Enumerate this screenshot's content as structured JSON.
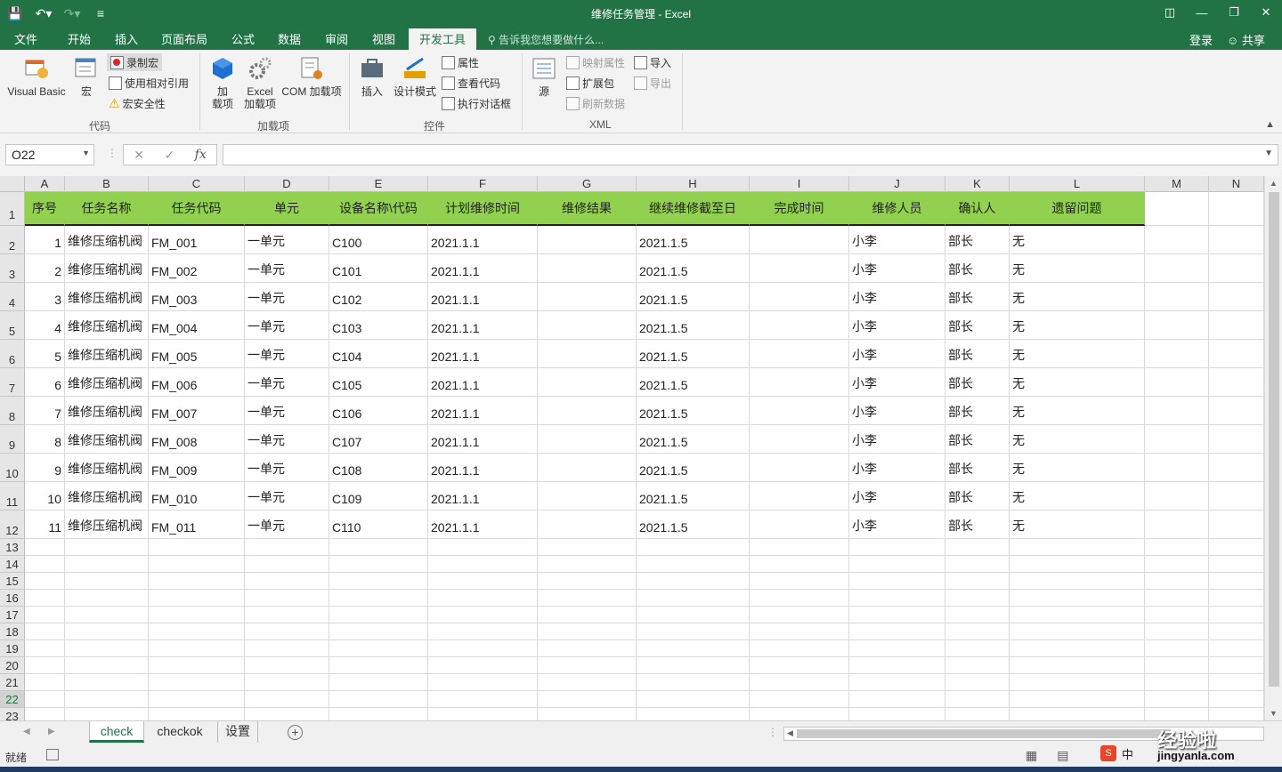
{
  "window": {
    "title": "维修任务管理 - Excel",
    "accent": "#217346"
  },
  "menu": {
    "tabs": [
      "文件",
      "开始",
      "插入",
      "页面布局",
      "公式",
      "数据",
      "审阅",
      "视图",
      "开发工具"
    ],
    "active_tab": "开发工具",
    "tell_me": "告诉我您想要做什么...",
    "login": "登录",
    "share": "共享"
  },
  "ribbon": {
    "code": {
      "group_label": "代码",
      "visual_basic": "Visual Basic",
      "macros": "宏",
      "record_macro": "录制宏",
      "relative_ref": "使用相对引用",
      "macro_security": "宏安全性"
    },
    "addins": {
      "group_label": "加载项",
      "addins": "加\n载项",
      "excel_addins": "Excel\n加载项",
      "com_addins": "COM 加载项"
    },
    "controls": {
      "group_label": "控件",
      "insert": "插入",
      "design_mode": "设计模式",
      "properties": "属性",
      "view_code": "查看代码",
      "run_dialog": "执行对话框"
    },
    "xml": {
      "group_label": "XML",
      "source": "源",
      "map_properties": "映射属性",
      "expansion_packs": "扩展包",
      "refresh_data": "刷新数据",
      "import": "导入",
      "export": "导出"
    }
  },
  "formula_bar": {
    "name_box": "O22",
    "fx": "fx",
    "value": ""
  },
  "sheet": {
    "columns": [
      "A",
      "B",
      "C",
      "D",
      "E",
      "F",
      "G",
      "H",
      "I",
      "J",
      "K",
      "L",
      "M",
      "N"
    ],
    "header_fill": "#92d050",
    "headers": [
      "序号",
      "任务名称",
      "任务代码",
      "单元",
      "设备名称\\代码",
      "计划维修时间",
      "维修结果",
      "继续维修截至日",
      "完成时间",
      "维修人员",
      "确认人",
      "遗留问题"
    ],
    "rows": [
      [
        "1",
        "维修压缩机阀",
        "FM_001",
        "一单元",
        "C100",
        "2021.1.1",
        "",
        "2021.1.5",
        "",
        "小李",
        "部长",
        "无"
      ],
      [
        "2",
        "维修压缩机阀",
        "FM_002",
        "一单元",
        "C101",
        "2021.1.1",
        "",
        "2021.1.5",
        "",
        "小李",
        "部长",
        "无"
      ],
      [
        "3",
        "维修压缩机阀",
        "FM_003",
        "一单元",
        "C102",
        "2021.1.1",
        "",
        "2021.1.5",
        "",
        "小李",
        "部长",
        "无"
      ],
      [
        "4",
        "维修压缩机阀",
        "FM_004",
        "一单元",
        "C103",
        "2021.1.1",
        "",
        "2021.1.5",
        "",
        "小李",
        "部长",
        "无"
      ],
      [
        "5",
        "维修压缩机阀",
        "FM_005",
        "一单元",
        "C104",
        "2021.1.1",
        "",
        "2021.1.5",
        "",
        "小李",
        "部长",
        "无"
      ],
      [
        "6",
        "维修压缩机阀",
        "FM_006",
        "一单元",
        "C105",
        "2021.1.1",
        "",
        "2021.1.5",
        "",
        "小李",
        "部长",
        "无"
      ],
      [
        "7",
        "维修压缩机阀",
        "FM_007",
        "一单元",
        "C106",
        "2021.1.1",
        "",
        "2021.1.5",
        "",
        "小李",
        "部长",
        "无"
      ],
      [
        "8",
        "维修压缩机阀",
        "FM_008",
        "一单元",
        "C107",
        "2021.1.1",
        "",
        "2021.1.5",
        "",
        "小李",
        "部长",
        "无"
      ],
      [
        "9",
        "维修压缩机阀",
        "FM_009",
        "一单元",
        "C108",
        "2021.1.1",
        "",
        "2021.1.5",
        "",
        "小李",
        "部长",
        "无"
      ],
      [
        "10",
        "维修压缩机阀",
        "FM_010",
        "一单元",
        "C109",
        "2021.1.1",
        "",
        "2021.1.5",
        "",
        "小李",
        "部长",
        "无"
      ],
      [
        "11",
        "维修压缩机阀",
        "FM_011",
        "一单元",
        "C110",
        "2021.1.1",
        "",
        "2021.1.5",
        "",
        "小李",
        "部长",
        "无"
      ]
    ],
    "row_numbers": [
      "1",
      "2",
      "3",
      "4",
      "5",
      "6",
      "7",
      "8",
      "9",
      "10",
      "11",
      "12",
      "13",
      "14",
      "15",
      "16",
      "17",
      "18",
      "19",
      "20",
      "21",
      "22",
      "23"
    ],
    "selected_row": "22"
  },
  "sheet_tabs": {
    "tabs": [
      "check",
      "checkok",
      "设置"
    ],
    "active": "check"
  },
  "status": {
    "ready": "就绪"
  },
  "ime": {
    "logo": "S",
    "lang": "中"
  },
  "watermark": {
    "text": "经验啦",
    "url": "jingyanla.com"
  }
}
